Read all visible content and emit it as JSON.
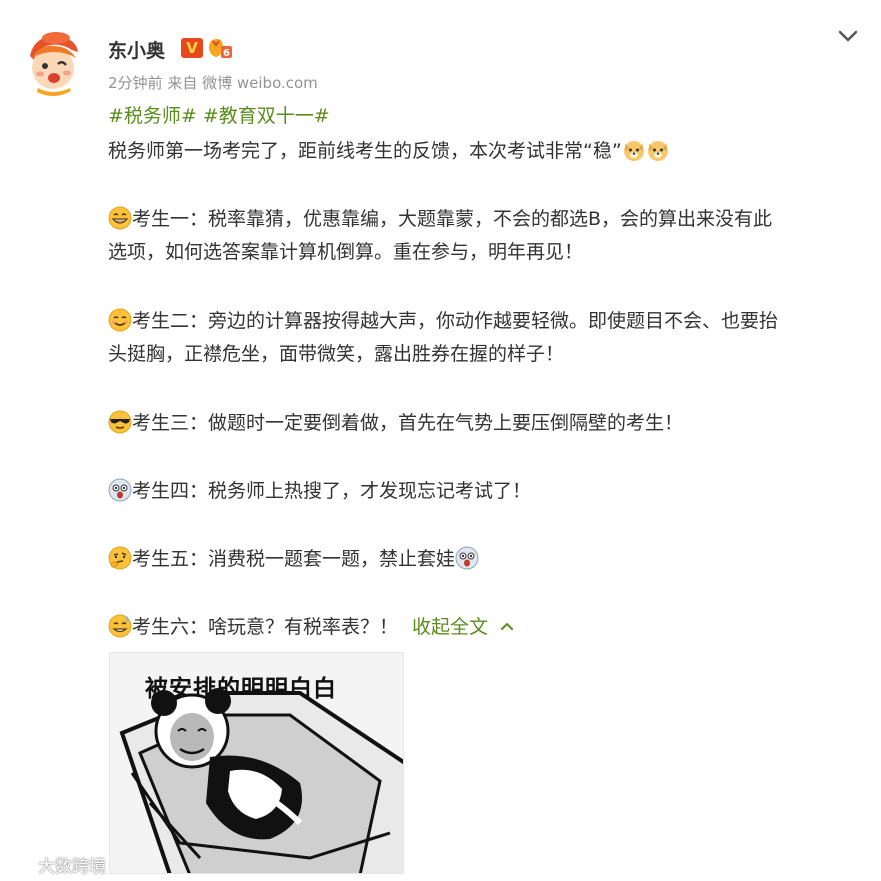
{
  "author": {
    "name": "东小奥",
    "vip_badge": "V"
  },
  "meta": {
    "time": "2分钟前",
    "source_prefix": "来自",
    "source": "微博 weibo.com"
  },
  "topics": [
    "#税务师#",
    "#教育双十一#"
  ],
  "lines": [
    "税务师第一场考完了，距前线考生的反馈，本次考试非常“稳”",
    "考生一：税率靠猜，优惠靠编，大题靠蒙，不会的都选B，会的算出来没有此",
    "选项，如何选答案靠计算机倒算。重在参与，明年再见！",
    "考生二：旁边的计算器按得越大声，你动作越要轻微。即使题目不会、也要抬",
    "头挺胸，正襟危坐，面带微笑，露出胜券在握的样子！",
    "考生三：做题时一定要倒着做，首先在气势上要压倒隔壁的考生！",
    "考生四：税务师上热搜了，才发现忘记考试了！",
    "考生五：消费税一题套一题，禁止套娃",
    "考生六：啥玩意？有税率表？！"
  ],
  "collapse_label": "收起全文",
  "meme_caption": "被安排的明明白白",
  "watermark": "大数跨境",
  "colors": {
    "accent_green": "#5b8c1d",
    "meta_gray": "#939393",
    "text": "#333333",
    "vip_red": "#e8481c"
  },
  "icons": {
    "avatar": "cartoon-mascot-avatar",
    "level": "level-badge-icon",
    "collapse": "chevron-down-icon",
    "collapse_up": "chevron-up-icon",
    "doge": "doge-emoji",
    "grin": "grin-emoji",
    "smile": "smile-emoji",
    "cool": "sunglasses-emoji",
    "shock": "shocked-emoji",
    "think": "thinking-emoji",
    "sweat": "sweat-emoji"
  }
}
